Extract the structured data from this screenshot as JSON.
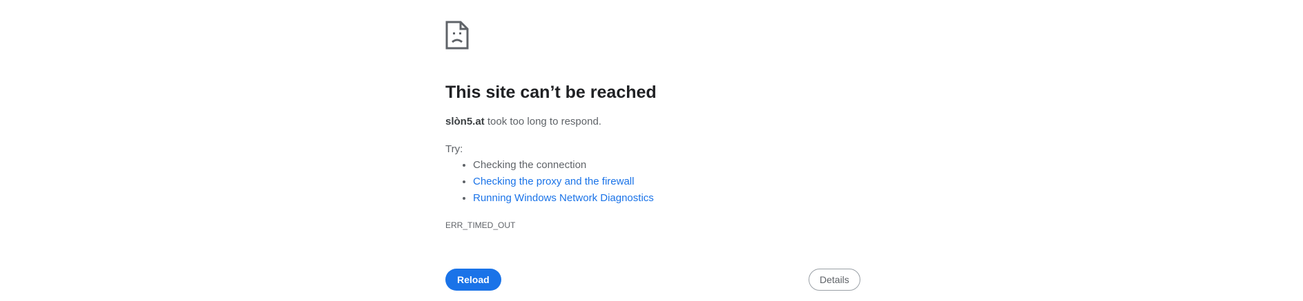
{
  "error": {
    "icon": "sad-page-icon",
    "title": "This site can’t be reached",
    "host": "slòn5.at",
    "summary_suffix": " took too long to respond.",
    "try_label": "Try:",
    "suggestions": [
      {
        "text": "Checking the connection",
        "is_link": false
      },
      {
        "text": "Checking the proxy and the firewall",
        "is_link": true
      },
      {
        "text": "Running Windows Network Diagnostics",
        "is_link": true
      }
    ],
    "code": "ERR_TIMED_OUT"
  },
  "buttons": {
    "reload_label": "Reload",
    "details_label": "Details"
  },
  "colors": {
    "link": "#1a73e8",
    "primary_button": "#1a73e8",
    "title": "#202124",
    "text": "#5f6368"
  }
}
